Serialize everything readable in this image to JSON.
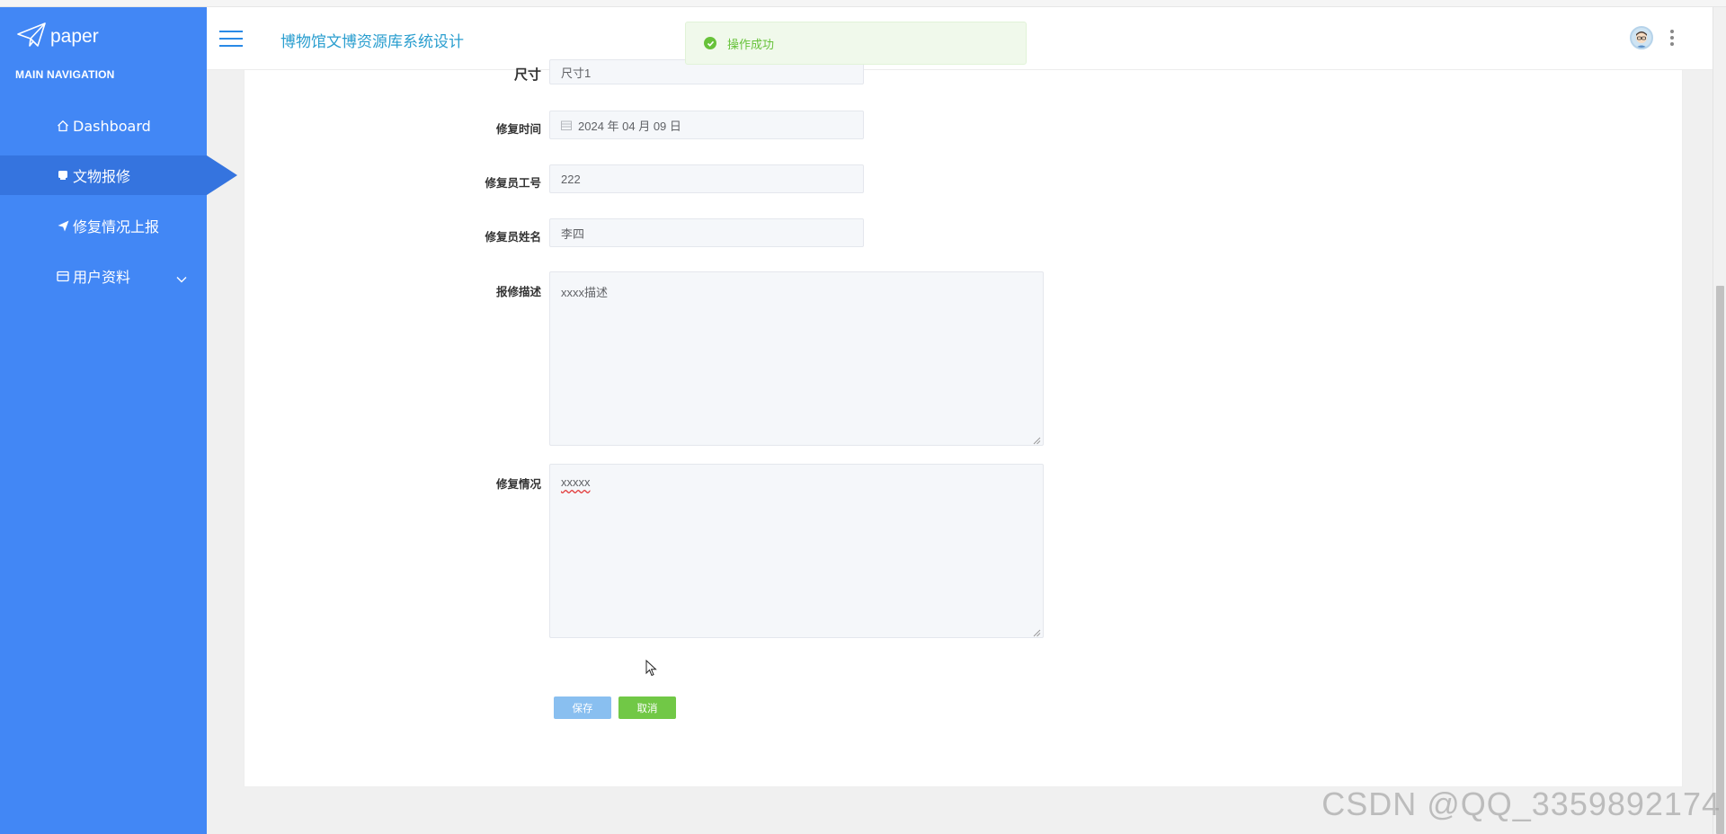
{
  "brand": {
    "logo_text": "paper"
  },
  "sidebar": {
    "heading": "MAIN NAVIGATION",
    "items": [
      {
        "label": "Dashboard",
        "icon": "home-icon",
        "active": false
      },
      {
        "label": "文物报修",
        "icon": "inbox-icon",
        "active": true
      },
      {
        "label": "修复情况上报",
        "icon": "send-icon",
        "active": false
      },
      {
        "label": "用户资料",
        "icon": "id-card-icon",
        "active": false,
        "has_submenu": true
      }
    ]
  },
  "header": {
    "title": "博物馆文博资源库系统设计"
  },
  "toast": {
    "message": "操作成功",
    "type": "success"
  },
  "form": {
    "size": {
      "label": "尺寸",
      "value": "尺寸1"
    },
    "repair_time": {
      "label": "修复时间",
      "value": "2024 年 04 月 09 日"
    },
    "repairer_id": {
      "label": "修复员工号",
      "value": "222"
    },
    "repairer_name": {
      "label": "修复员姓名",
      "value": "李四"
    },
    "repair_desc": {
      "label": "报修描述",
      "value": "xxxx描述"
    },
    "repair_status": {
      "label": "修复情况",
      "value": "xxxxx"
    },
    "save_label": "保存",
    "cancel_label": "取消"
  },
  "watermark": "CSDN @QQ_3359892174",
  "colors": {
    "sidebar_bg": "#4287f5",
    "sidebar_active": "#3574df",
    "title_color": "#2a9ecf",
    "success": "#67c23a",
    "save_button": "#89bff0",
    "cancel_button": "#71c846"
  }
}
